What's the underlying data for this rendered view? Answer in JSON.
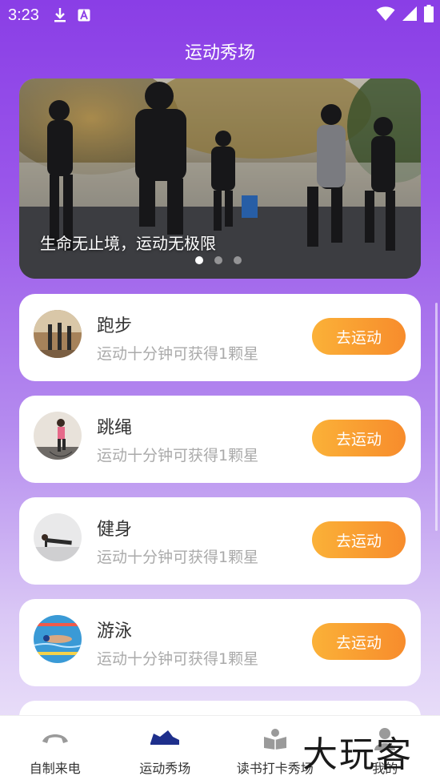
{
  "status_bar": {
    "time": "3:23",
    "icons": [
      "download-icon",
      "a-icon",
      "wifi-icon",
      "signal-icon",
      "battery-icon"
    ]
  },
  "header": {
    "title": "运动秀场"
  },
  "banner": {
    "caption": "生命无止境，运动无极限",
    "dots": 3,
    "active_dot": 0
  },
  "activities": [
    {
      "title": "跑步",
      "subtitle": "运动十分钟可获得1颗星",
      "button": "去运动",
      "icon": "running-photo"
    },
    {
      "title": "跳绳",
      "subtitle": "运动十分钟可获得1颗星",
      "button": "去运动",
      "icon": "jump-rope-photo"
    },
    {
      "title": "健身",
      "subtitle": "运动十分钟可获得1颗星",
      "button": "去运动",
      "icon": "fitness-photo"
    },
    {
      "title": "游泳",
      "subtitle": "运动十分钟可获得1颗星",
      "button": "去运动",
      "icon": "swimming-photo"
    }
  ],
  "tabbar": {
    "items": [
      {
        "label": "自制来电",
        "icon": "phone-icon",
        "active": false
      },
      {
        "label": "运动秀场",
        "icon": "sneaker-icon",
        "active": true
      },
      {
        "label": "读书打卡秀场",
        "icon": "book-icon",
        "active": false
      },
      {
        "label": "我的",
        "icon": "profile-icon",
        "active": false
      }
    ]
  },
  "colors": {
    "accent": "#8a3ee6",
    "button_start": "#fbb138",
    "button_end": "#f78c2c",
    "active_tab": "#1e2f8c"
  }
}
